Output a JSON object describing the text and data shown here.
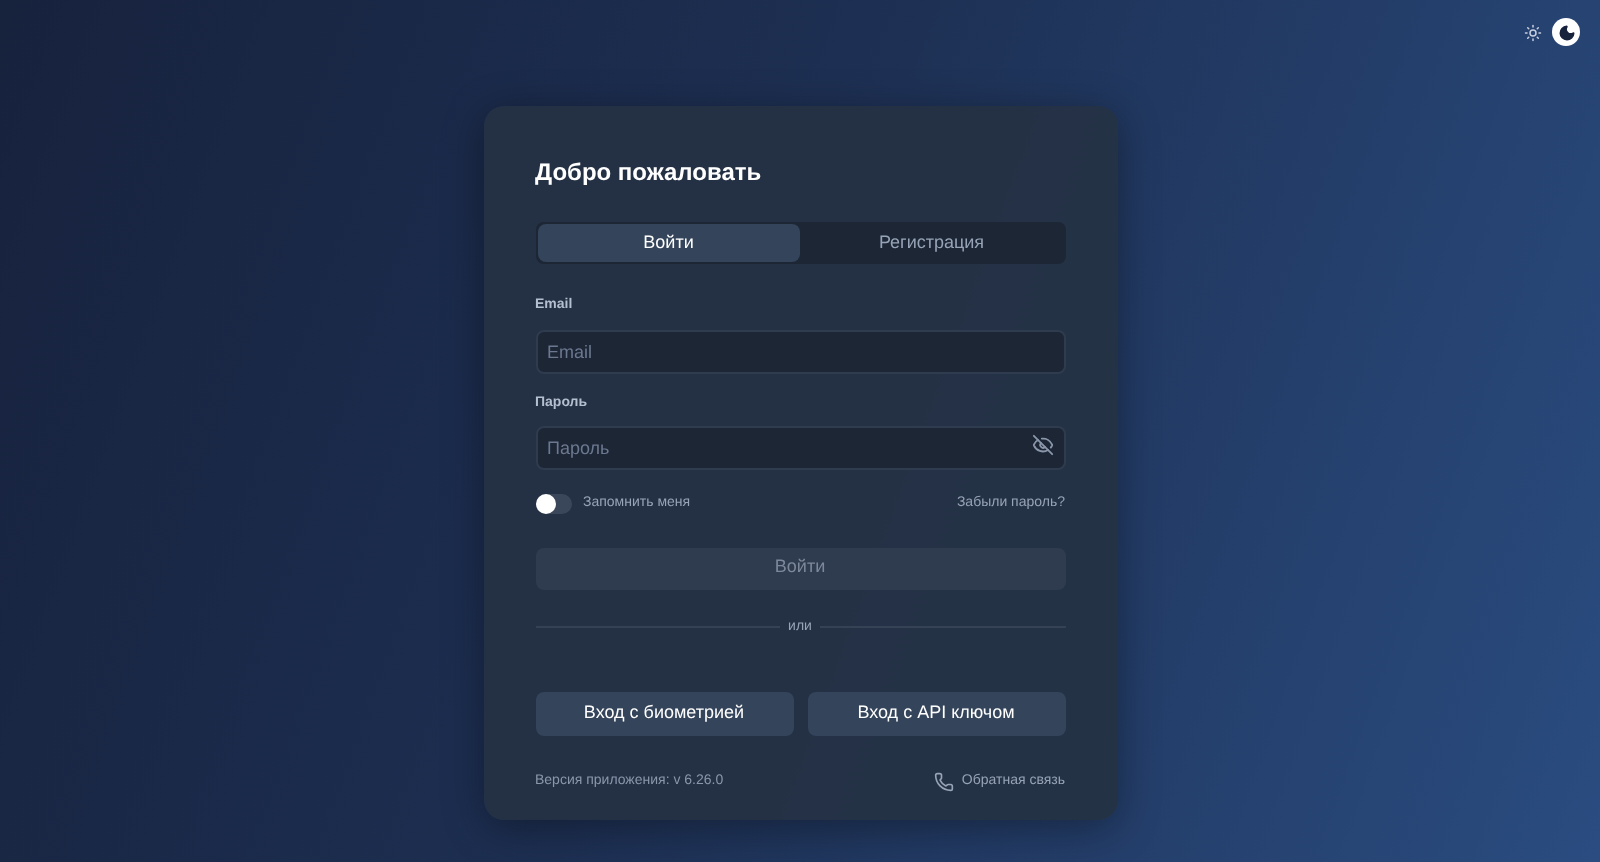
{
  "theme_toggle": [
    {
      "kind": "sun",
      "selected": false
    },
    {
      "kind": "moon",
      "selected": true
    }
  ],
  "title": "Добро пожаловать",
  "tabs": [
    {
      "label": "Войти",
      "selected": true
    },
    {
      "label": "Регистрация",
      "selected": false
    }
  ],
  "fields": [
    {
      "label": "Email",
      "placeholder": "Email",
      "kind": "text"
    },
    {
      "label": "Пароль",
      "placeholder": "Пароль",
      "kind": "password"
    }
  ],
  "remember_me": {
    "label": "Запомнить меня",
    "on": false
  },
  "forgot_link": "Забыли пароль?",
  "submit": {
    "label": "Войти",
    "disabled": true
  },
  "divider": "или",
  "alt_buttons": [
    "Вход с биометрией",
    "Вход с API ключом"
  ],
  "version": "Версия приложения: v 6.26.0",
  "feedback": "Обратная связь"
}
